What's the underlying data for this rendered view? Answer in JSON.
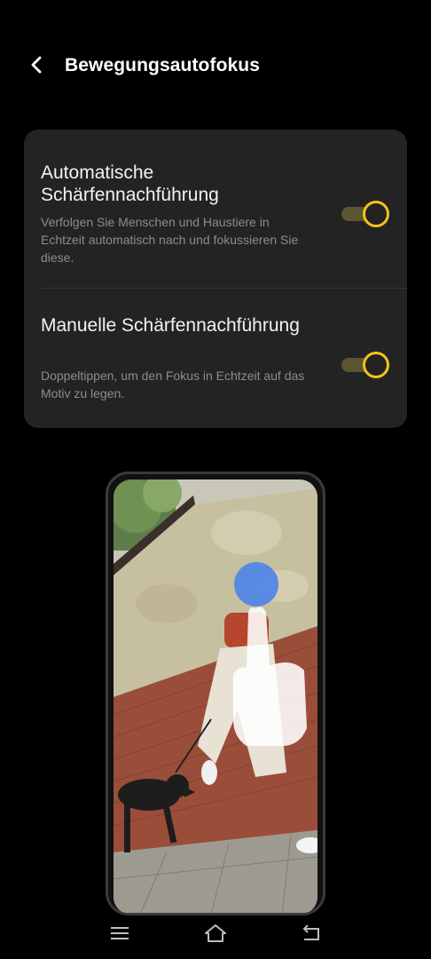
{
  "header": {
    "back_icon": "chevron-left-icon",
    "title": "Bewegungsautofokus"
  },
  "settings": [
    {
      "title": "Automatische Schärfennachführung",
      "description": "Verfolgen Sie Menschen und Haustiere in Echtzeit automatisch nach und fokussieren Sie diese.",
      "enabled": true
    },
    {
      "title": "Manuelle Schärfennachführung",
      "description": "Doppeltippen, um den Fokus in Echtzeit auf das Motiv zu legen.",
      "enabled": true
    }
  ],
  "illustration": {
    "kind": "phone-with-tap-gesture",
    "gesture_icon": "tap-gesture-icon"
  },
  "navbar": {
    "icons": [
      "menu-icon",
      "home-icon",
      "back-icon"
    ]
  },
  "colors": {
    "background": "#000000",
    "card": "#232323",
    "accent": "#f0c419",
    "toggle_track": "#5b5532",
    "secondary_text": "#8c8c8c",
    "gesture_dot": "#4f86e6"
  }
}
